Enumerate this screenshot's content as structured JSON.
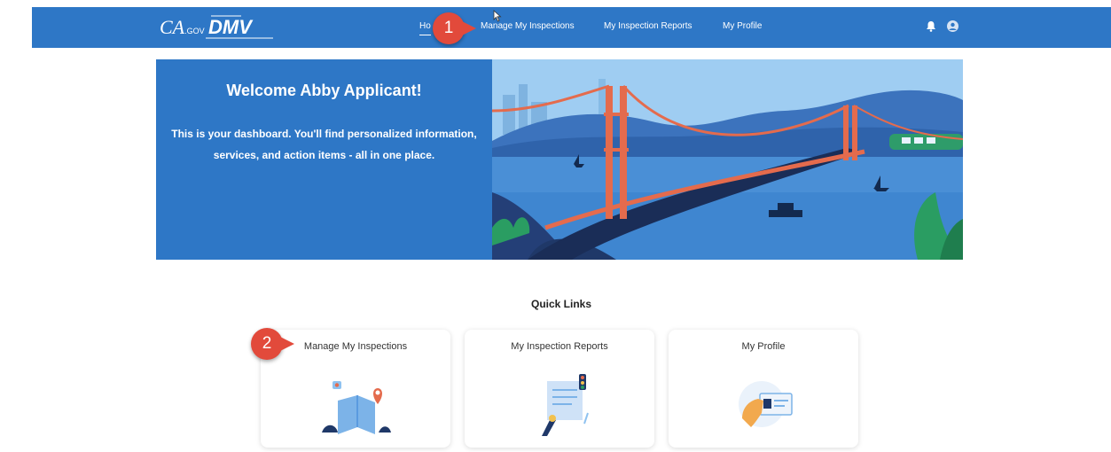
{
  "header": {
    "ca_logo_main": "CA",
    "ca_logo_sub": ".GOV",
    "nav": {
      "home": "Ho",
      "manage": "Manage My Inspections",
      "reports": "My Inspection Reports",
      "profile": "My Profile"
    },
    "icons": [
      "bell-icon",
      "user-avatar-icon"
    ]
  },
  "callouts": {
    "one": "1",
    "two": "2"
  },
  "hero": {
    "title": "Welcome Abby Applicant!",
    "text": "This is your dashboard. You'll find personalized information, services, and action items - all in one place."
  },
  "quick_links": {
    "title": "Quick Links",
    "cards": [
      {
        "label": "Manage My Inspections"
      },
      {
        "label": "My Inspection Reports"
      },
      {
        "label": "My Profile"
      }
    ]
  },
  "colors": {
    "brand_blue": "#2e77c6",
    "callout_red": "#e24a3b",
    "bridge": "#e46b4d"
  }
}
